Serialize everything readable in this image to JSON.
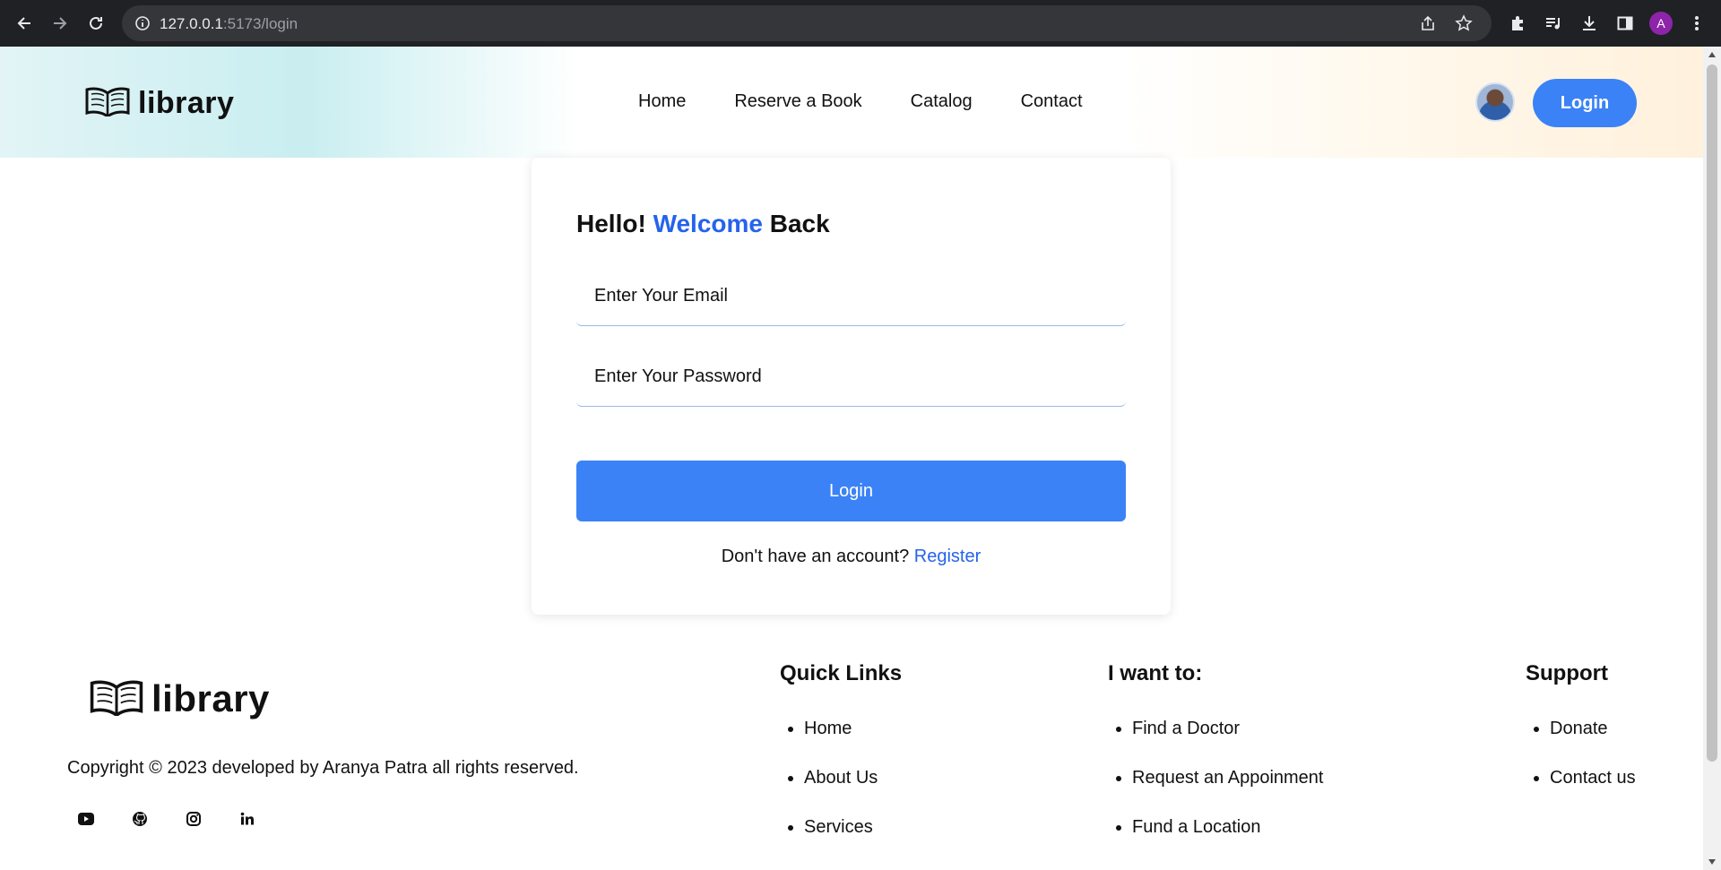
{
  "browser": {
    "url_host": "127.0.0.1",
    "url_path": ":5173/login",
    "profile_initial": "A"
  },
  "header": {
    "logo_text": "library",
    "nav": [
      "Home",
      "Reserve a Book",
      "Catalog",
      "Contact"
    ],
    "login_label": "Login"
  },
  "login_card": {
    "title_hello": "Hello!",
    "title_welcome": "Welcome",
    "title_back": "Back",
    "email_placeholder": "Enter Your Email",
    "password_placeholder": "Enter Your Password",
    "submit_label": "Login",
    "register_prompt": "Don't have an account?",
    "register_link": "Register"
  },
  "footer": {
    "logo_text": "library",
    "copyright": "Copyright © 2023 developed by Aranya Patra all rights reserved.",
    "socials": [
      "youtube-icon",
      "github-icon",
      "instagram-icon",
      "linkedin-icon"
    ],
    "quick_links": {
      "heading": "Quick Links",
      "items": [
        "Home",
        "About Us",
        "Services"
      ]
    },
    "i_want_to": {
      "heading": "I want to:",
      "items": [
        "Find a Doctor",
        "Request an Appoinment",
        "Fund a Location"
      ]
    },
    "support": {
      "heading": "Support",
      "items": [
        "Donate",
        "Contact us"
      ]
    }
  },
  "colors": {
    "accent": "#3b82f6",
    "accent_text": "#2563eb",
    "chrome_bg": "#202124"
  }
}
